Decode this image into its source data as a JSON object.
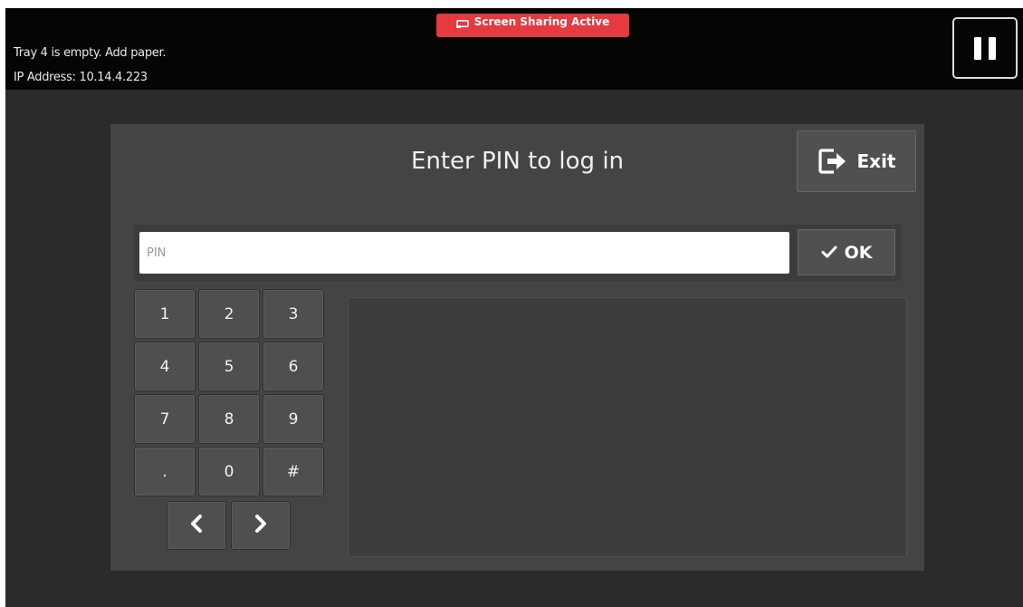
{
  "status_bar": {
    "message": "Tray 4 is empty.  Add paper.",
    "ip_line": "IP Address: 10.14.4.223",
    "sharing_label": "Screen Sharing Active",
    "sharing_icon": "screen-cast-icon",
    "pause_icon": "pause-icon"
  },
  "dialog": {
    "title": "Enter PIN to log in",
    "exit_label": "Exit",
    "exit_icon": "exit-door-arrow-icon"
  },
  "pin": {
    "value": "",
    "placeholder": "PIN"
  },
  "ok": {
    "label": "OK",
    "icon": "checkmark-icon"
  },
  "keypad": {
    "keys": [
      "1",
      "2",
      "3",
      "4",
      "5",
      "6",
      "7",
      "8",
      "9",
      ".",
      "0",
      "#"
    ],
    "nav": [
      "chevron-left-icon",
      "chevron-right-icon"
    ]
  },
  "colors": {
    "screen_background": "#2b2b2b",
    "status_bar_background": "#050505",
    "dialog_background": "#444444",
    "sharing_badge": "#e53a3f"
  }
}
